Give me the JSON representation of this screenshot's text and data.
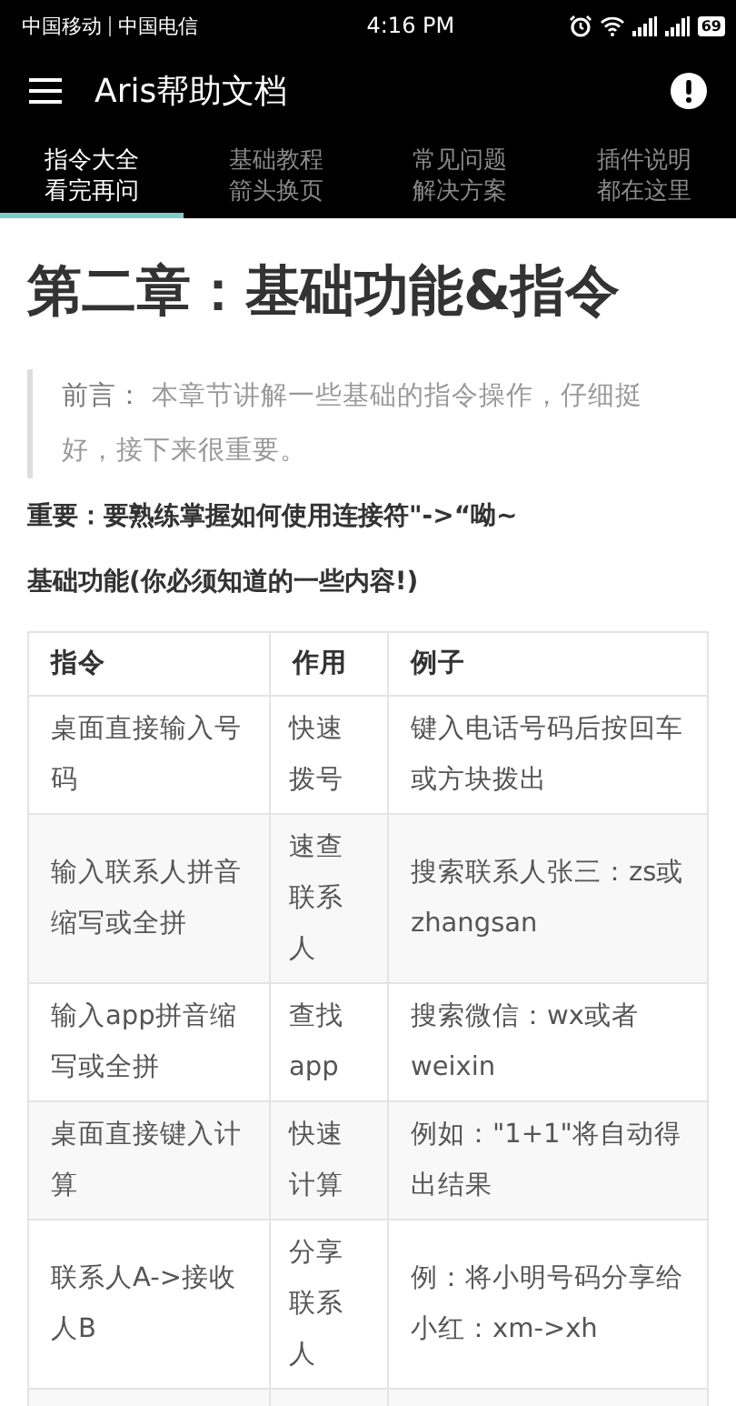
{
  "status_bar": {
    "carriers": "中国移动",
    "carrier_2": "中国电信",
    "time": "4:16 PM",
    "battery": "69"
  },
  "toolbar": {
    "title": "Aris帮助文档"
  },
  "tabs": [
    {
      "label": "指令大全看完再问",
      "selected": true
    },
    {
      "label": "基础教程箭头换页",
      "selected": false
    },
    {
      "label": "常见问题解决方案",
      "selected": false
    },
    {
      "label": "插件说明都在这里",
      "selected": false
    }
  ],
  "article": {
    "heading": "第二章：基础功能&指令",
    "quote": {
      "lead": "前言：",
      "text": "本章节讲解一些基础的指令操作，仔细挺好，接下来很重要。"
    },
    "important": "重要：要熟练掌握如何使用连接符\"->“呦~",
    "subheading": "基础功能(你必须知道的一些内容!)",
    "table": {
      "columns": [
        "指令",
        "作用",
        "例子"
      ],
      "rows": [
        [
          "桌面直接输入号码",
          "快速拨号",
          "键入电话号码后按回车或方块拨出"
        ],
        [
          "输入联系人拼音缩写或全拼",
          "速查联系人",
          "搜索联系人张三：zs或zhangsan"
        ],
        [
          "输入app拼音缩写或全拼",
          "查找app",
          "搜索微信：wx或者weixin"
        ],
        [
          "桌面直接键入计算",
          "快速计算",
          "例如：\"1+1\"将自动得出结果"
        ],
        [
          "联系人A->接收人B",
          "分享联系人",
          "例：将小明号码分享给小红：xm->xh"
        ]
      ]
    }
  }
}
